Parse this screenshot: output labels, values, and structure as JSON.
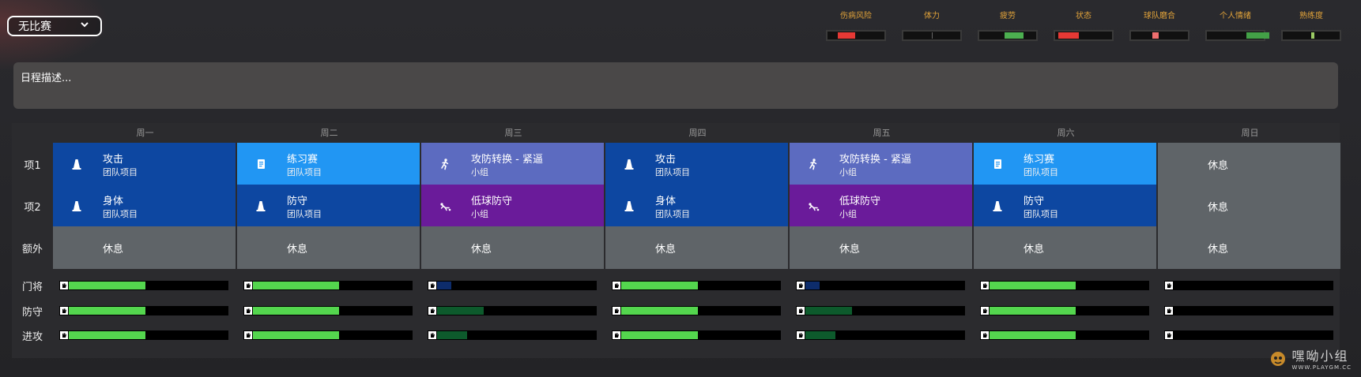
{
  "match_select": {
    "value": "无比赛",
    "icon": "chevron-down-icon"
  },
  "metrics": [
    {
      "label": "伤病风险",
      "value": 0.3,
      "color": "#e53935"
    },
    {
      "label": "体力",
      "value": 0.0,
      "color": "#666666"
    },
    {
      "label": "疲劳",
      "value": 0.33,
      "color": "#4caf50"
    },
    {
      "label": "状态",
      "value": 0.37,
      "color": "#e53935"
    },
    {
      "label": "球队磨合",
      "value": 0.1,
      "color": "#ef6f6f"
    },
    {
      "label": "个人情绪",
      "value": 0.4,
      "color": "#43a047"
    },
    {
      "label": "熟练度",
      "value": 0.05,
      "color": "#9ccc65"
    }
  ],
  "schedule_description": {
    "text": "日程描述..."
  },
  "days": [
    "周一",
    "周二",
    "周三",
    "周四",
    "周五",
    "周六",
    "周日"
  ],
  "rows": [
    {
      "label": "项1",
      "cells": [
        {
          "title": "攻击",
          "subtitle": "团队项目",
          "icon": "cone-icon",
          "color": "#0d47a1"
        },
        {
          "title": "练习赛",
          "subtitle": "团队项目",
          "icon": "document-icon",
          "color": "#2196f3"
        },
        {
          "title": "攻防转换 - 紧逼",
          "subtitle": "小组",
          "icon": "running-figure-icon",
          "color": "#5c6bc0"
        },
        {
          "title": "攻击",
          "subtitle": "团队项目",
          "icon": "cone-icon",
          "color": "#0d47a1"
        },
        {
          "title": "攻防转换 - 紧逼",
          "subtitle": "小组",
          "icon": "running-figure-icon",
          "color": "#5c6bc0"
        },
        {
          "title": "练习赛",
          "subtitle": "团队项目",
          "icon": "document-icon",
          "color": "#2196f3"
        },
        {
          "title": "休息",
          "subtitle": "",
          "icon": "",
          "color": "#5f6468"
        }
      ]
    },
    {
      "label": "项2",
      "cells": [
        {
          "title": "身体",
          "subtitle": "团队项目",
          "icon": "cone-icon",
          "color": "#0d47a1"
        },
        {
          "title": "防守",
          "subtitle": "团队项目",
          "icon": "cone-icon",
          "color": "#0d47a1"
        },
        {
          "title": "低球防守",
          "subtitle": "小组",
          "icon": "slide-tackle-icon",
          "color": "#6a1b9a"
        },
        {
          "title": "身体",
          "subtitle": "团队项目",
          "icon": "cone-icon",
          "color": "#0d47a1"
        },
        {
          "title": "低球防守",
          "subtitle": "小组",
          "icon": "slide-tackle-icon",
          "color": "#6a1b9a"
        },
        {
          "title": "防守",
          "subtitle": "团队项目",
          "icon": "cone-icon",
          "color": "#0d47a1"
        },
        {
          "title": "休息",
          "subtitle": "",
          "icon": "",
          "color": "#5f6468"
        }
      ]
    },
    {
      "label": "额外",
      "cells": [
        {
          "title": "休息",
          "subtitle": "",
          "icon": "",
          "color": "#5f6468"
        },
        {
          "title": "休息",
          "subtitle": "",
          "icon": "",
          "color": "#5f6468"
        },
        {
          "title": "休息",
          "subtitle": "",
          "icon": "",
          "color": "#5f6468"
        },
        {
          "title": "休息",
          "subtitle": "",
          "icon": "",
          "color": "#5f6468"
        },
        {
          "title": "休息",
          "subtitle": "",
          "icon": "",
          "color": "#5f6468"
        },
        {
          "title": "休息",
          "subtitle": "",
          "icon": "",
          "color": "#5f6468"
        },
        {
          "title": "休息",
          "subtitle": "",
          "icon": "",
          "color": "#5f6468"
        }
      ]
    }
  ],
  "position_bars": [
    {
      "label": "门将",
      "values": [
        {
          "value": 0.48,
          "color": "#54d64e"
        },
        {
          "value": 0.54,
          "color": "#54d64e"
        },
        {
          "value": 0.09,
          "color": "#0d2c6b"
        },
        {
          "value": 0.48,
          "color": "#54d64e"
        },
        {
          "value": 0.09,
          "color": "#0d2c6b"
        },
        {
          "value": 0.54,
          "color": "#54d64e"
        },
        {
          "value": 0.0,
          "color": "#54d64e"
        }
      ]
    },
    {
      "label": "防守",
      "values": [
        {
          "value": 0.48,
          "color": "#54d64e"
        },
        {
          "value": 0.54,
          "color": "#54d64e"
        },
        {
          "value": 0.29,
          "color": "#0d5a2c"
        },
        {
          "value": 0.48,
          "color": "#54d64e"
        },
        {
          "value": 0.29,
          "color": "#0d5a2c"
        },
        {
          "value": 0.54,
          "color": "#54d64e"
        },
        {
          "value": 0.0,
          "color": "#54d64e"
        }
      ]
    },
    {
      "label": "进攻",
      "values": [
        {
          "value": 0.48,
          "color": "#54d64e"
        },
        {
          "value": 0.54,
          "color": "#54d64e"
        },
        {
          "value": 0.19,
          "color": "#0d5a2c"
        },
        {
          "value": 0.48,
          "color": "#54d64e"
        },
        {
          "value": 0.19,
          "color": "#0d5a2c"
        },
        {
          "value": 0.54,
          "color": "#54d64e"
        },
        {
          "value": 0.0,
          "color": "#54d64e"
        }
      ]
    }
  ],
  "watermark": {
    "name": "嘿呦小组",
    "url": "WWW.PLAYGM.CC",
    "icon": "mascot-logo-icon"
  }
}
